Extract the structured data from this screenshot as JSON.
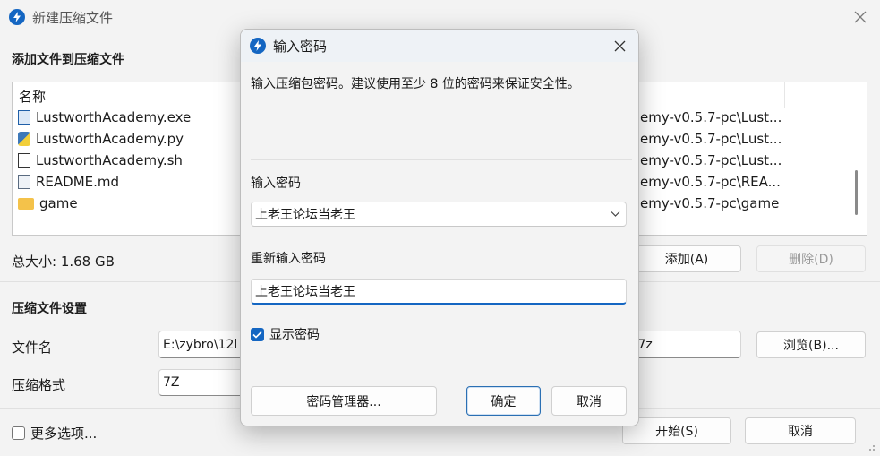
{
  "window": {
    "title": "新建压缩文件"
  },
  "files_section": {
    "heading": "添加文件到压缩文件",
    "column_name": "名称",
    "files": [
      {
        "name": "LustworthAcademy.exe",
        "icon": "exe-file-icon",
        "path": "emy-v0.5.7-pc\\Lust..."
      },
      {
        "name": "LustworthAcademy.py",
        "icon": "python-file-icon",
        "path": "emy-v0.5.7-pc\\Lust..."
      },
      {
        "name": "LustworthAcademy.sh",
        "icon": "shell-file-icon",
        "path": "emy-v0.5.7-pc\\Lust..."
      },
      {
        "name": "README.md",
        "icon": "markdown-file-icon",
        "path": "emy-v0.5.7-pc\\REA..."
      },
      {
        "name": "game",
        "icon": "folder-icon",
        "path": "emy-v0.5.7-pc\\game"
      }
    ],
    "total_size": "总大小: 1.68 GB",
    "add_button": "添加(A)",
    "delete_button": "删除(D)"
  },
  "settings_section": {
    "heading": "压缩文件设置",
    "filename_label": "文件名",
    "filename_value_left": "E:\\zybro\\12l",
    "filename_value_right": ".7z",
    "browse_button": "浏览(B)...",
    "format_label": "压缩格式",
    "format_value": "7Z",
    "more_options": "更多选项...",
    "start_button": "开始(S)",
    "cancel_button": "取消"
  },
  "dialog": {
    "title": "输入密码",
    "hint": "输入压缩包密码。建议使用至少 8 位的密码来保证安全性。",
    "password_label": "输入密码",
    "password_value": "上老王论坛当老王",
    "confirm_label": "重新输入密码",
    "confirm_value": "上老王论坛当老王",
    "show_password": "显示密码",
    "manager_button": "密码管理器...",
    "ok_button": "确定",
    "cancel_button": "取消"
  },
  "colors": {
    "accent": "#1466c2",
    "background": "#f3f3f3"
  }
}
